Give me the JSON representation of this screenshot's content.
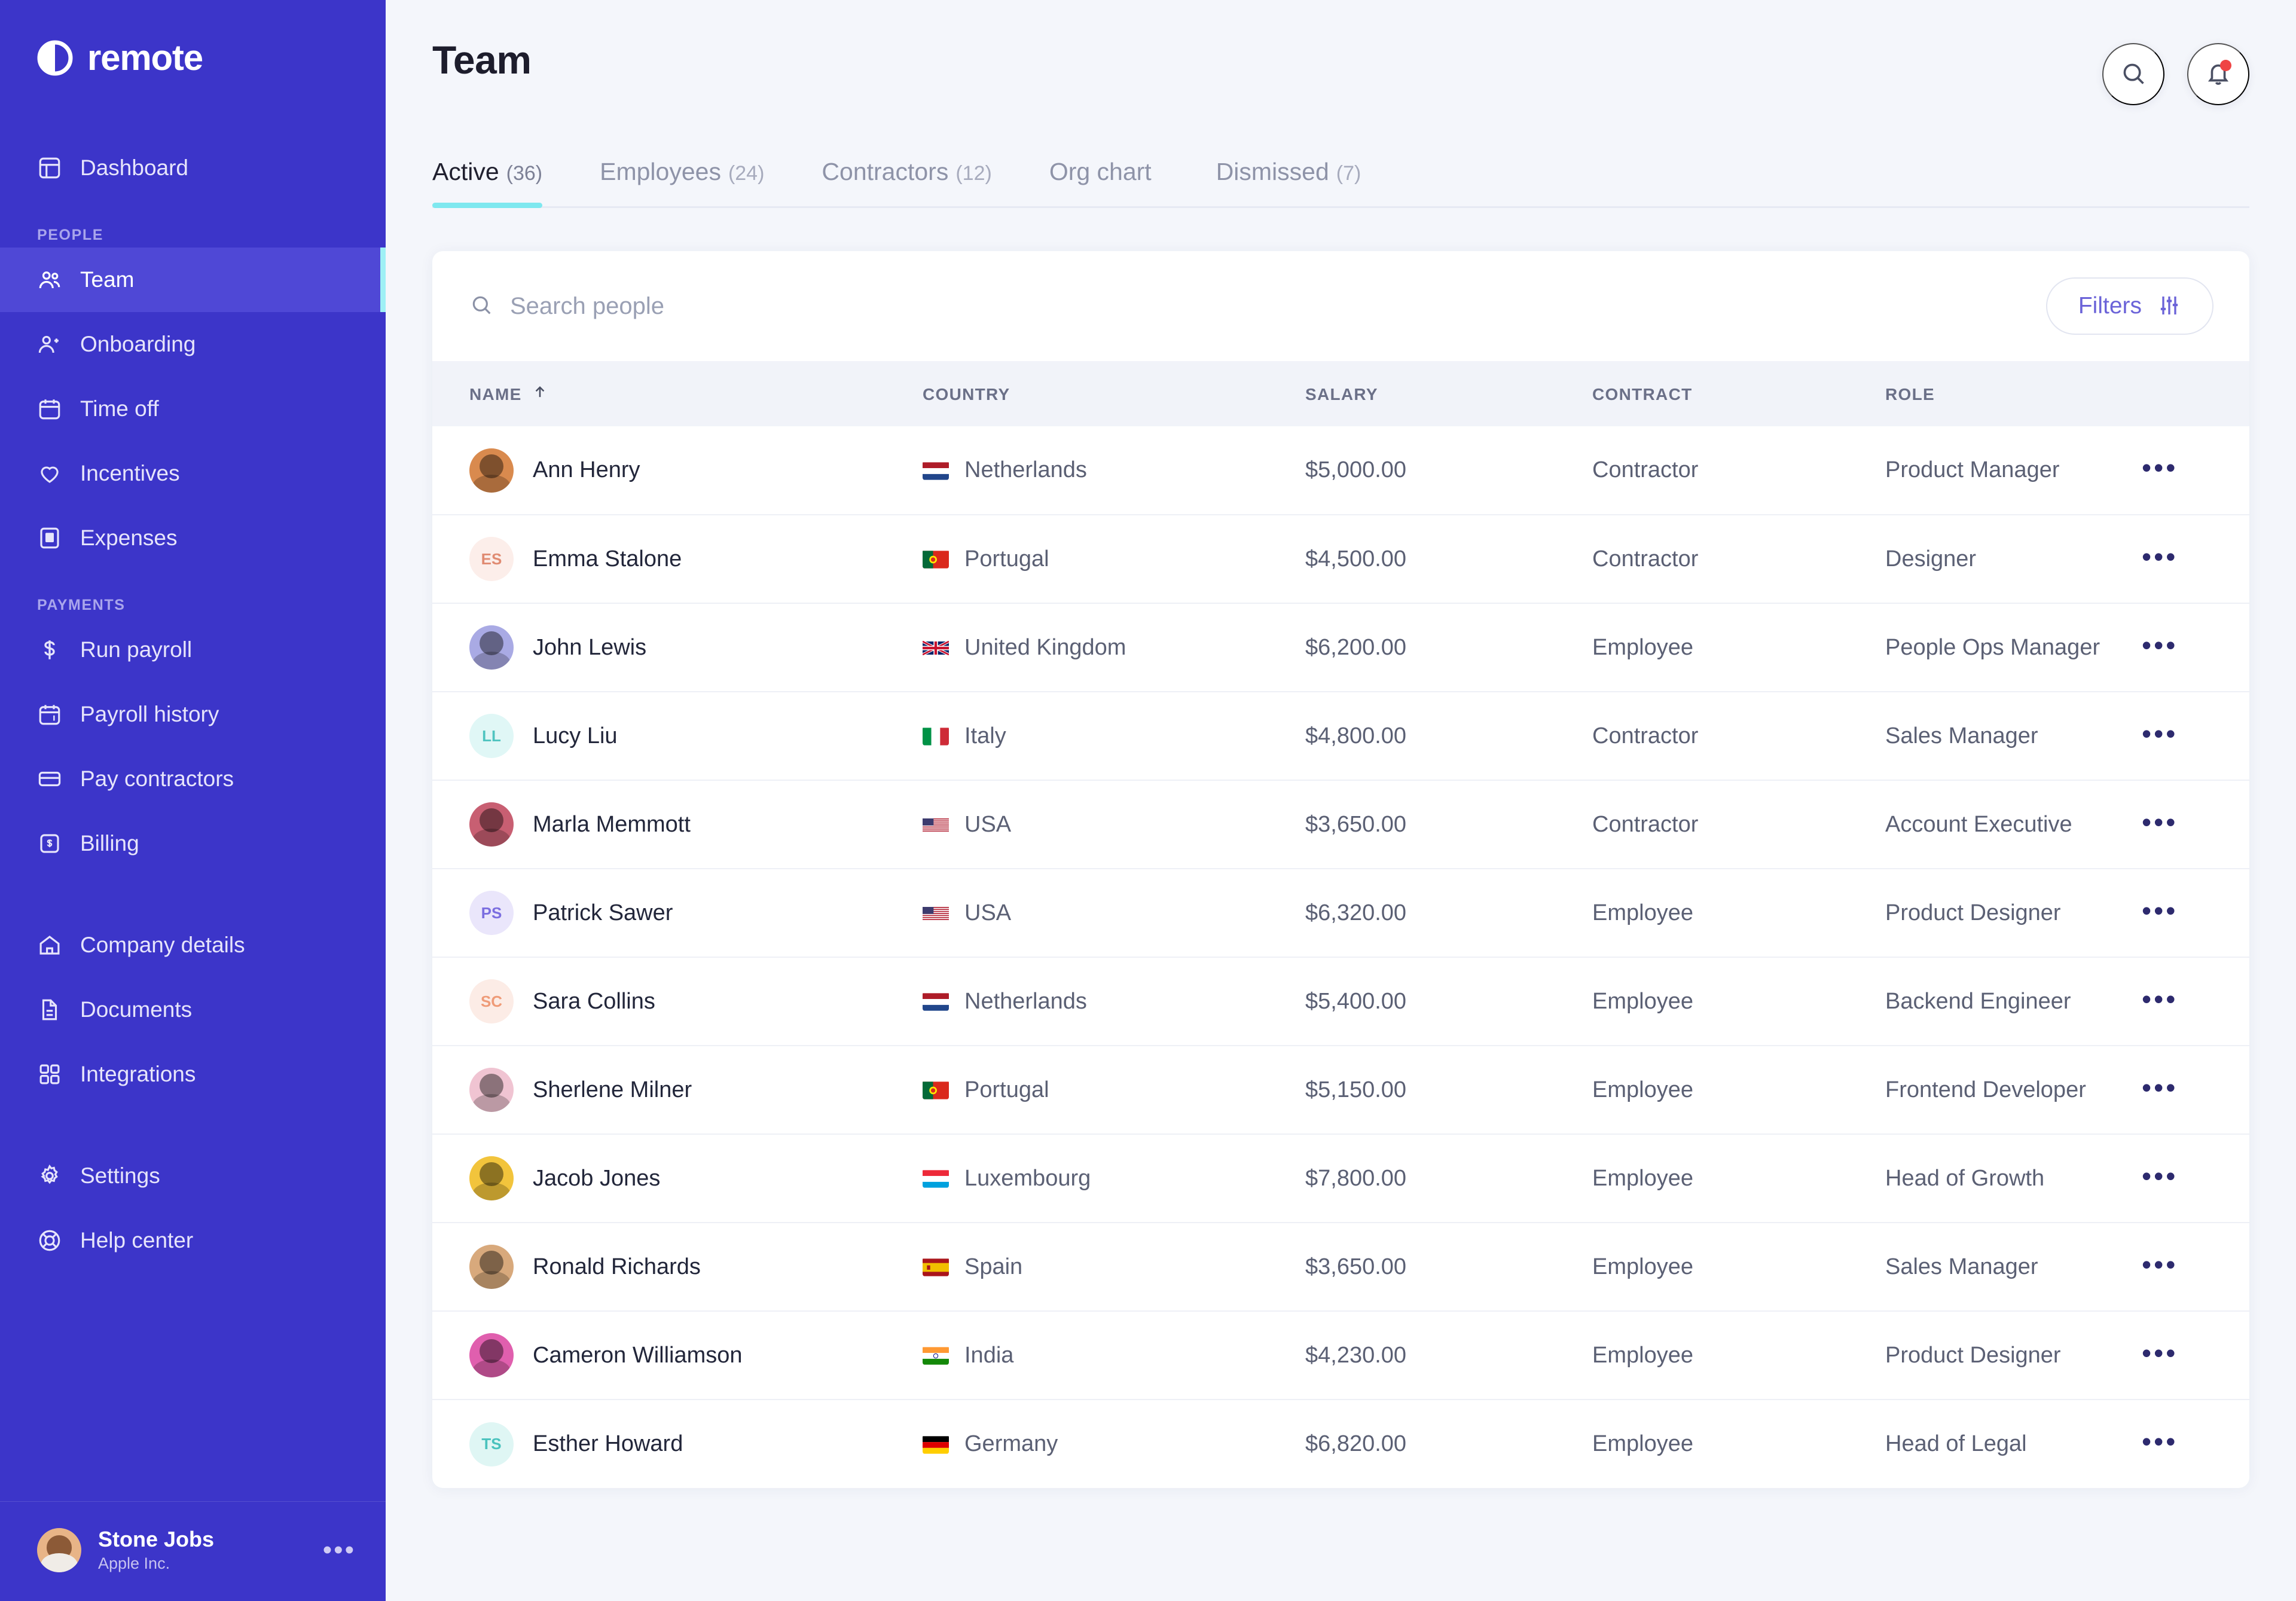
{
  "brand": {
    "name": "remote",
    "primary": "#3c35c9",
    "accent": "#7ee8ef"
  },
  "sidebar": {
    "top_items": [
      {
        "label": "Dashboard",
        "icon": "dashboard-icon"
      }
    ],
    "sections": [
      {
        "label": "PEOPLE",
        "items": [
          {
            "label": "Team",
            "icon": "people-icon",
            "active": true
          },
          {
            "label": "Onboarding",
            "icon": "person-add-icon"
          },
          {
            "label": "Time off",
            "icon": "calendar-icon"
          },
          {
            "label": "Incentives",
            "icon": "heart-icon"
          },
          {
            "label": "Expenses",
            "icon": "receipt-icon"
          }
        ]
      },
      {
        "label": "PAYMENTS",
        "items": [
          {
            "label": "Run payroll",
            "icon": "dollar-icon"
          },
          {
            "label": "Payroll history",
            "icon": "calendar-dollar-icon"
          },
          {
            "label": "Pay contractors",
            "icon": "credit-card-icon"
          },
          {
            "label": "Billing",
            "icon": "billing-icon"
          }
        ]
      }
    ],
    "utility_items": [
      {
        "label": "Company details",
        "icon": "home-icon"
      },
      {
        "label": "Documents",
        "icon": "document-icon"
      },
      {
        "label": "Integrations",
        "icon": "grid-icon"
      }
    ],
    "bottom_items": [
      {
        "label": "Settings",
        "icon": "gear-icon"
      },
      {
        "label": "Help center",
        "icon": "help-icon"
      }
    ],
    "user": {
      "name": "Stone Jobs",
      "org": "Apple Inc.",
      "menu": "•••"
    }
  },
  "header": {
    "title": "Team",
    "search_icon": "search-icon",
    "notifications_icon": "bell-icon"
  },
  "tabs": [
    {
      "label": "Active",
      "count": "(36)",
      "active": true
    },
    {
      "label": "Employees",
      "count": "(24)",
      "active": false
    },
    {
      "label": "Contractors",
      "count": "(12)",
      "active": false
    },
    {
      "label": "Org chart",
      "count": "",
      "active": false
    },
    {
      "label": "Dismissed",
      "count": "(7)",
      "active": false
    }
  ],
  "toolbar": {
    "search_placeholder": "Search people",
    "search_value": "",
    "filters_label": "Filters",
    "filters_icon": "sliders-icon"
  },
  "table": {
    "columns": [
      "NAME",
      "COUNTRY",
      "SALARY",
      "CONTRACT",
      "ROLE"
    ],
    "sort_column": "NAME",
    "sort_direction": "asc",
    "row_menu": "•••",
    "rows": [
      {
        "name": "Ann Henry",
        "avatar_type": "photo",
        "avatar_bg": "#d98a4e",
        "initials": "",
        "country": "Netherlands",
        "flag": "nl",
        "salary": "$5,000.00",
        "contract": "Contractor",
        "role": "Product Manager"
      },
      {
        "name": "Emma Stalone",
        "avatar_type": "initials",
        "avatar_bg": "#fceeea",
        "initials": "ES",
        "initials_color": "#e08b72",
        "country": "Portugal",
        "flag": "pt",
        "salary": "$4,500.00",
        "contract": "Contractor",
        "role": "Designer"
      },
      {
        "name": "John Lewis",
        "avatar_type": "photo",
        "avatar_bg": "#a9aae4",
        "initials": "",
        "country": "United Kingdom",
        "flag": "gb",
        "salary": "$6,200.00",
        "contract": "Employee",
        "role": "People Ops Manager"
      },
      {
        "name": "Lucy Liu",
        "avatar_type": "initials",
        "avatar_bg": "#e0f7f6",
        "initials": "LL",
        "initials_color": "#4fc4c0",
        "country": "Italy",
        "flag": "it",
        "salary": "$4,800.00",
        "contract": "Contractor",
        "role": "Sales Manager"
      },
      {
        "name": "Marla Memmott",
        "avatar_type": "photo",
        "avatar_bg": "#c85f72",
        "initials": "",
        "country": "USA",
        "flag": "us",
        "salary": "$3,650.00",
        "contract": "Contractor",
        "role": "Account Executive"
      },
      {
        "name": "Patrick Sawer",
        "avatar_type": "initials",
        "avatar_bg": "#eae6fb",
        "initials": "PS",
        "initials_color": "#7b6ee0",
        "country": "USA",
        "flag": "us",
        "salary": "$6,320.00",
        "contract": "Employee",
        "role": "Product Designer"
      },
      {
        "name": "Sara Collins",
        "avatar_type": "initials",
        "avatar_bg": "#fcece6",
        "initials": "SC",
        "initials_color": "#ef9b78",
        "country": "Netherlands",
        "flag": "nl",
        "salary": "$5,400.00",
        "contract": "Employee",
        "role": "Backend Engineer"
      },
      {
        "name": "Sherlene Milner",
        "avatar_type": "photo",
        "avatar_bg": "#f0c4d2",
        "initials": "",
        "country": "Portugal",
        "flag": "pt",
        "salary": "$5,150.00",
        "contract": "Employee",
        "role": "Frontend Developer"
      },
      {
        "name": "Jacob Jones",
        "avatar_type": "photo",
        "avatar_bg": "#f2c43c",
        "initials": "",
        "country": "Luxembourg",
        "flag": "lu",
        "salary": "$7,800.00",
        "contract": "Employee",
        "role": "Head of Growth"
      },
      {
        "name": "Ronald Richards",
        "avatar_type": "photo",
        "avatar_bg": "#d8a97c",
        "initials": "",
        "country": "Spain",
        "flag": "es",
        "salary": "$3,650.00",
        "contract": "Employee",
        "role": "Sales Manager"
      },
      {
        "name": "Cameron Williamson",
        "avatar_type": "photo",
        "avatar_bg": "#e05fae",
        "initials": "",
        "country": "India",
        "flag": "in",
        "salary": "$4,230.00",
        "contract": "Employee",
        "role": "Product Designer"
      },
      {
        "name": "Esther Howard",
        "avatar_type": "initials",
        "avatar_bg": "#dff6f4",
        "initials": "TS",
        "initials_color": "#49c2bd",
        "country": "Germany",
        "flag": "de",
        "salary": "$6,820.00",
        "contract": "Employee",
        "role": "Head of Legal"
      }
    ]
  }
}
